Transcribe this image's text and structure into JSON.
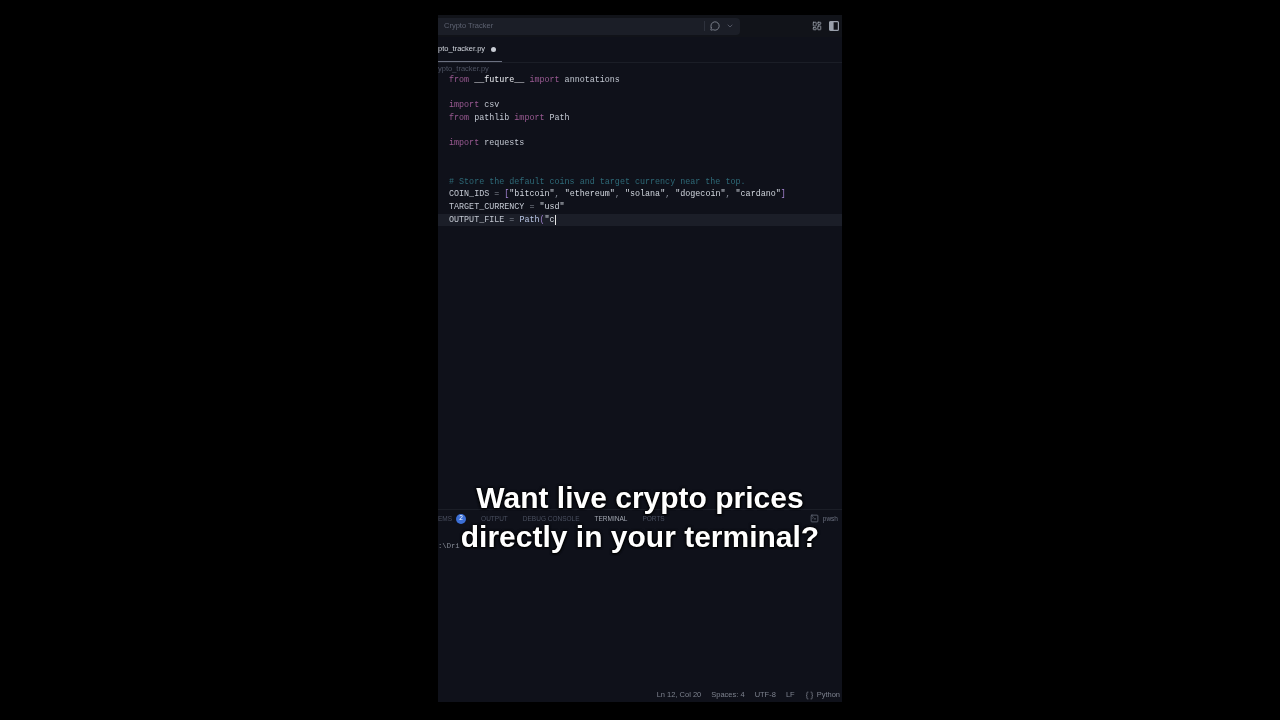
{
  "title_bar": {
    "title": "Crypto Tracker"
  },
  "tabs": [
    {
      "label": "pto_tracker.py",
      "selected": true,
      "modified": true
    }
  ],
  "breadcrumb": "ypto_tracker.py",
  "editor": {
    "lines": [
      {
        "kind": "code",
        "current": false,
        "tokens": [
          {
            "text": "from",
            "kind": "keyword"
          },
          {
            "text": " __future__ ",
            "kind": "module"
          },
          {
            "text": "import",
            "kind": "keyword"
          },
          {
            "text": " annotations",
            "kind": "name"
          }
        ]
      },
      {
        "kind": "blank"
      },
      {
        "kind": "code",
        "current": false,
        "tokens": [
          {
            "text": "import",
            "kind": "keyword"
          },
          {
            "text": " csv",
            "kind": "name"
          }
        ]
      },
      {
        "kind": "code",
        "current": false,
        "tokens": [
          {
            "text": "from",
            "kind": "keyword"
          },
          {
            "text": " pathlib ",
            "kind": "name"
          },
          {
            "text": "import",
            "kind": "keyword"
          },
          {
            "text": " Path",
            "kind": "name"
          }
        ]
      },
      {
        "kind": "blank"
      },
      {
        "kind": "code",
        "current": false,
        "tokens": [
          {
            "text": "import",
            "kind": "keyword"
          },
          {
            "text": " requests",
            "kind": "name"
          }
        ]
      },
      {
        "kind": "blank"
      },
      {
        "kind": "blank"
      },
      {
        "kind": "code",
        "current": false,
        "tokens": [
          {
            "text": "# Store the default coins and target currency near the top.",
            "kind": "comment"
          }
        ]
      },
      {
        "kind": "code",
        "current": false,
        "tokens": [
          {
            "text": "COIN_IDS",
            "kind": "name"
          },
          {
            "text": " = ",
            "kind": "operator"
          },
          {
            "text": "[",
            "kind": "bracket"
          },
          {
            "text": "\"bitcoin\"",
            "kind": "string"
          },
          {
            "text": ", ",
            "kind": "punct"
          },
          {
            "text": "\"ethereum\"",
            "kind": "string"
          },
          {
            "text": ", ",
            "kind": "punct"
          },
          {
            "text": "\"solana\"",
            "kind": "string"
          },
          {
            "text": ", ",
            "kind": "punct"
          },
          {
            "text": "\"dogecoin\"",
            "kind": "string"
          },
          {
            "text": ", ",
            "kind": "punct"
          },
          {
            "text": "\"cardano\"",
            "kind": "string"
          },
          {
            "text": "]",
            "kind": "bracket"
          }
        ]
      },
      {
        "kind": "code",
        "current": false,
        "tokens": [
          {
            "text": "TARGET_CURRENCY",
            "kind": "name"
          },
          {
            "text": " = ",
            "kind": "operator"
          },
          {
            "text": "\"usd\"",
            "kind": "string"
          }
        ]
      },
      {
        "kind": "code",
        "current": true,
        "tokens": [
          {
            "text": "OUTPUT_FILE",
            "kind": "name"
          },
          {
            "text": " = ",
            "kind": "operator"
          },
          {
            "text": "Path",
            "kind": "call"
          },
          {
            "text": "(",
            "kind": "bracket"
          },
          {
            "text": "\"c",
            "kind": "string"
          }
        ]
      }
    ]
  },
  "panel": {
    "tabs": [
      {
        "label": "EMS",
        "badge": "2",
        "selected": false
      },
      {
        "label": "OUTPUT",
        "selected": false
      },
      {
        "label": "DEBUG CONSOLE",
        "selected": false
      },
      {
        "label": "TERMINAL",
        "selected": true
      },
      {
        "label": "PORTS",
        "selected": false
      }
    ],
    "shell": "pwsh",
    "terminal_text": ":\\Dri"
  },
  "status_bar": {
    "items": [
      "Ln 12, Col 20",
      "Spaces: 4",
      "UTF-8",
      "LF"
    ],
    "language": "Python"
  },
  "caption": {
    "lines": [
      "Want live crypto prices",
      "directly in your terminal?"
    ]
  }
}
